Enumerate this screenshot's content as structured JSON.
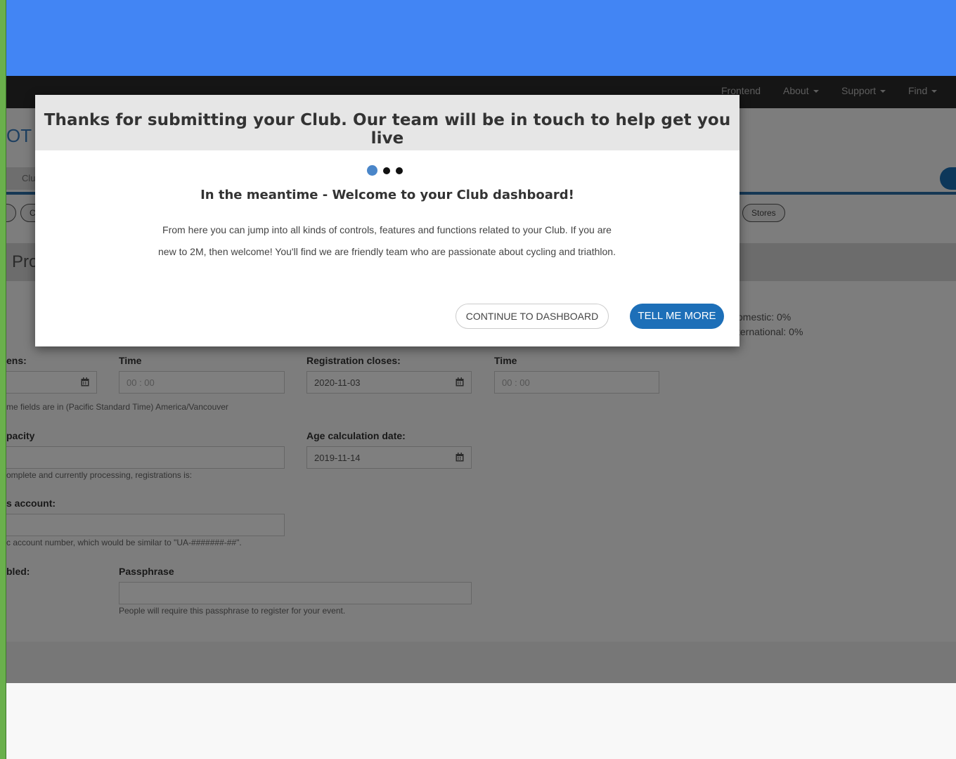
{
  "navbar": {
    "items": [
      {
        "label": "Frontend"
      },
      {
        "label": "About"
      },
      {
        "label": "Support"
      },
      {
        "label": "Find"
      }
    ]
  },
  "page": {
    "brand_fragment": "OT /",
    "tab_fragment": "Clu",
    "pill_fragment": "C",
    "stores_pill": "Stores",
    "section_fragment": "Pro",
    "stats": {
      "domestic": "omestic: 0%",
      "international": "ternational: 0%"
    },
    "registration": {
      "opens_label": "ens:",
      "time_label_1": "Time",
      "time_value_1": "00 : 00",
      "closes_label": "Registration closes:",
      "closes_value": "2020-11-03",
      "time_label_2": "Time",
      "time_value_2": "00 : 00",
      "timezone_note": "me fields are in (Pacific Standard Time) America/Vancouver"
    },
    "capacity": {
      "label": "pacity",
      "help": "omplete and currently processing, registrations is:"
    },
    "age": {
      "label": "Age calculation date:",
      "value": "2019-11-14"
    },
    "account": {
      "label": "s account:",
      "help": "c account number, which would be similar to \"UA-#######-##\"."
    },
    "enabled": {
      "label": "bled:"
    },
    "passphrase": {
      "label": "Passphrase",
      "help": "People will require this passphrase to register for your event."
    }
  },
  "modal": {
    "title": "Thanks for submitting your Club. Our team will be in touch to help get you live",
    "subtitle": "In the meantime - Welcome to your Club dashboard!",
    "body": "From here you can jump into all kinds of controls, features and functions related to your Club. If you are new to 2M, then welcome! You'll find we are friendly team who are passionate about cycling and triathlon.",
    "continue_label": "CONTINUE TO DASHBOARD",
    "more_label": "TELL ME MORE",
    "dots": {
      "total": 3,
      "active": 1
    }
  },
  "colors": {
    "top_bar": "#4285f4",
    "left_bar": "#6ab04c",
    "navbar": "#2a2a2a",
    "primary_button": "#1d6fb8",
    "active_dot": "#4a86c9"
  }
}
